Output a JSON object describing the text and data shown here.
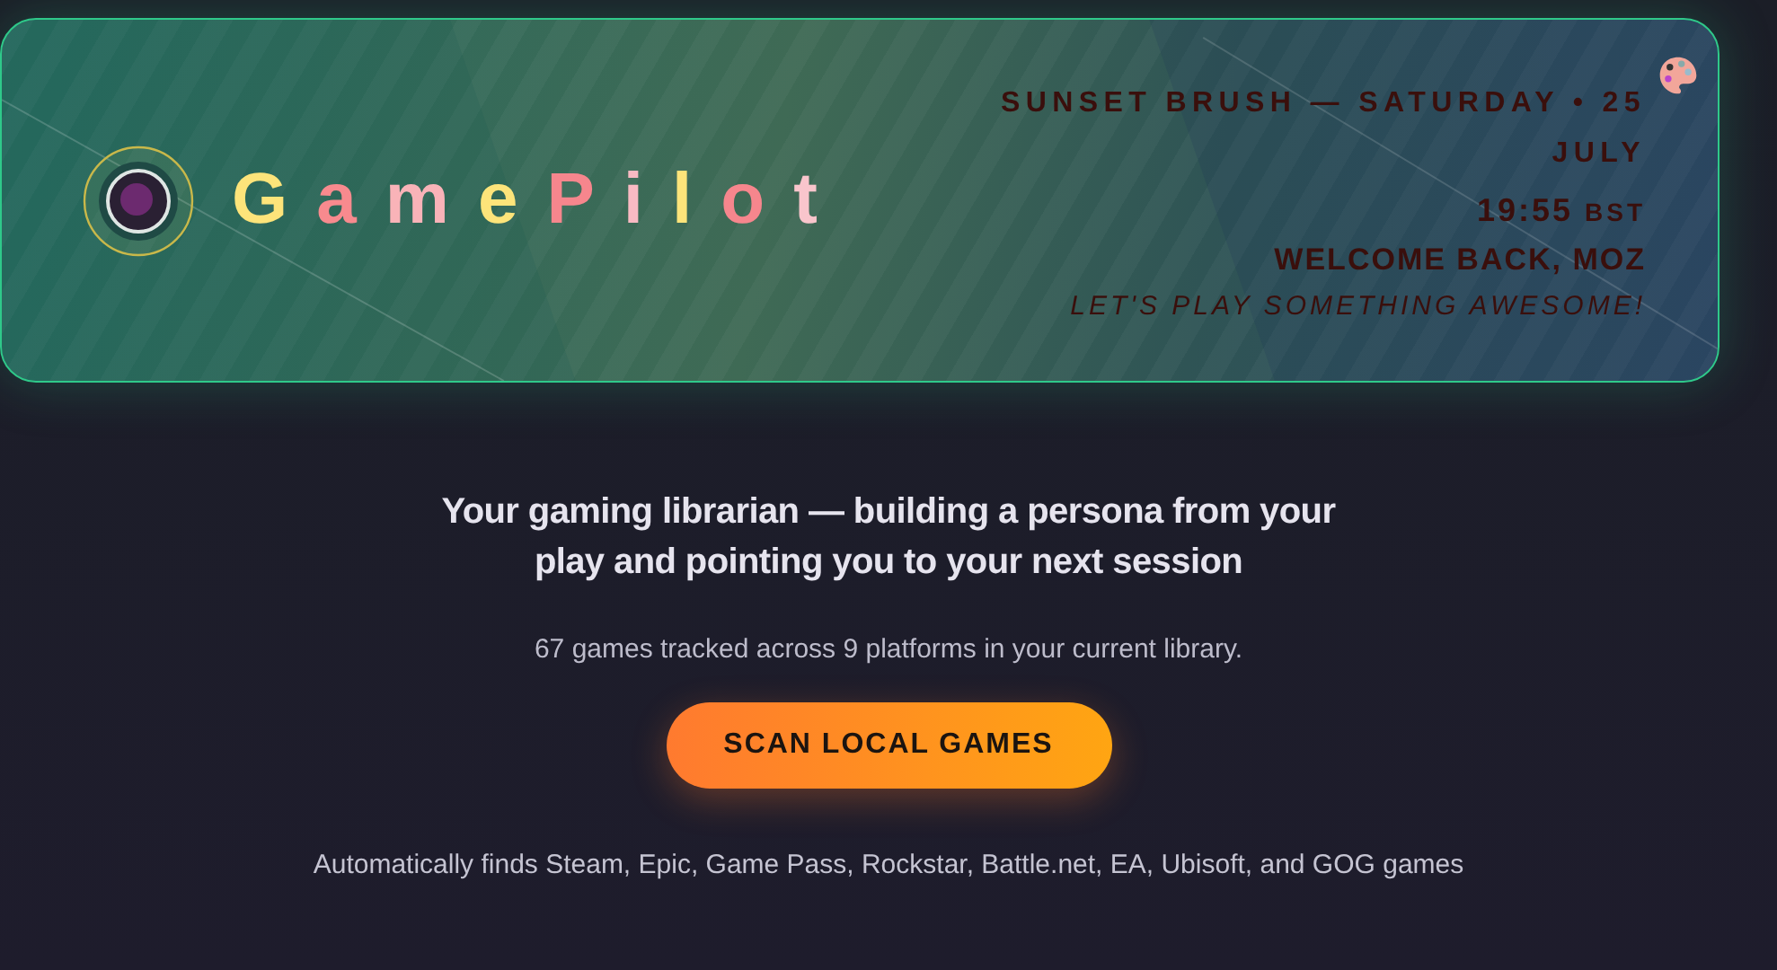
{
  "hero": {
    "logo": "GamePilot",
    "theme_date": "SUNSET BRUSH — SATURDAY • 25 JULY",
    "time": "19:55",
    "timezone": "BST",
    "welcome": "WELCOME BACK, MOZ",
    "motto": "LET'S PLAY SOMETHING AWESOME!"
  },
  "tagline": "Your gaming librarian — building a persona from your play and pointing you to your next session",
  "summary": "67 games tracked across 9 platforms in your current library.",
  "scan_button": "SCAN LOCAL GAMES",
  "footnote": "Automatically finds Steam, Epic, Game Pass, Rockstar, Battle.net, EA, Ubisoft, and GOG games"
}
